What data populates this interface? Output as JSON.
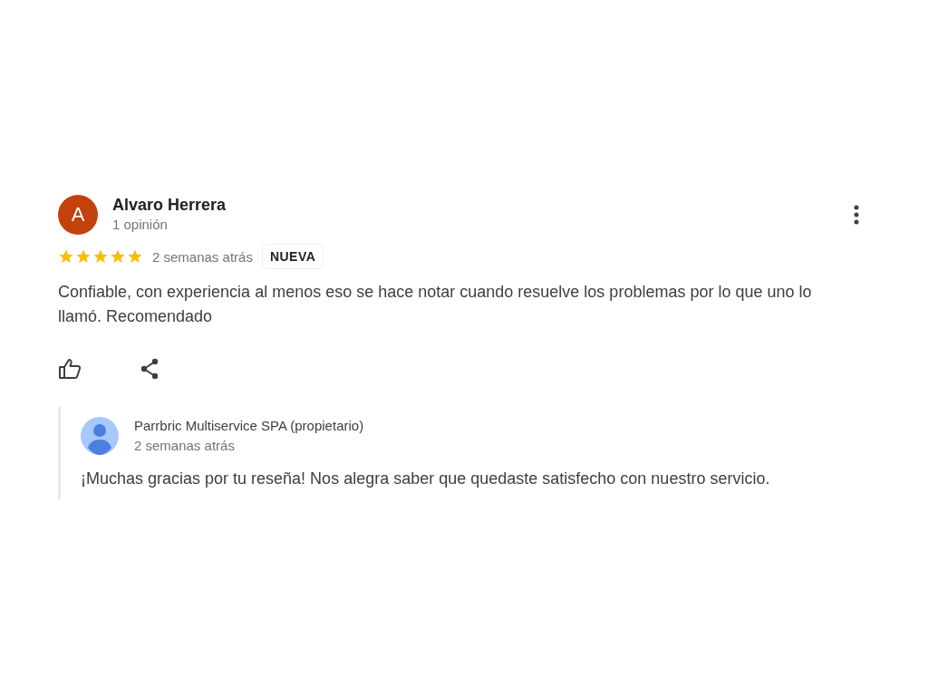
{
  "review": {
    "author": "Alvaro Herrera",
    "avatar_letter": "A",
    "review_count": "1 opinión",
    "stars": 5,
    "time": "2 semanas atrás",
    "badge": "NUEVA",
    "text": "Confiable, con experiencia al menos eso se hace notar cuando resuelve los problemas por lo que uno lo llamó. Recomendado"
  },
  "reply": {
    "author": "Parrbric Multiservice SPA (propietario)",
    "time": "2 semanas atrás",
    "text": "¡Muchas gracias por tu reseña! Nos alegra saber que quedaste satisfecho con nuestro servicio."
  }
}
